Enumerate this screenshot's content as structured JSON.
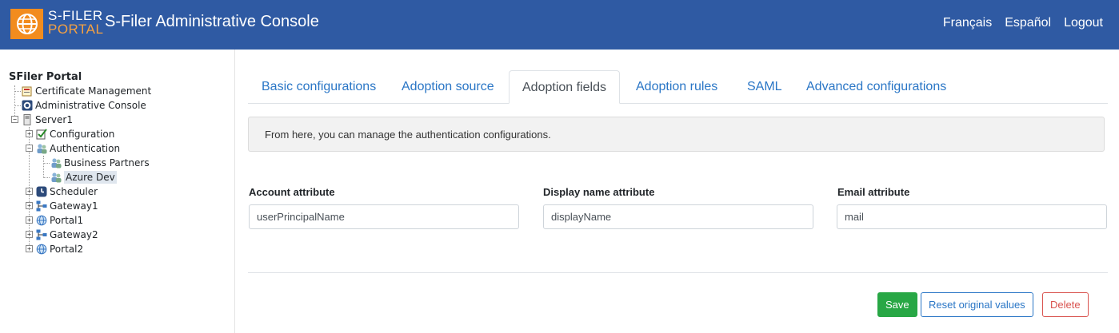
{
  "header": {
    "logo_line1": "S-FILER",
    "logo_line2": "PORTAL",
    "title": "S-Filer Administrative Console",
    "links": [
      "Français",
      "Español",
      "Logout"
    ],
    "logo_bg": "#f28c1e",
    "bar_color": "#2f5aa3"
  },
  "tree": {
    "root": "SFiler Portal",
    "nodes": [
      {
        "label": "Certificate Management",
        "icon": "certificate-icon"
      },
      {
        "label": "Administrative Console",
        "icon": "gear-icon"
      },
      {
        "label": "Server1",
        "icon": "server-icon",
        "expanded": true
      },
      {
        "label": "Configuration",
        "icon": "checklist-icon",
        "expanded": false
      },
      {
        "label": "Authentication",
        "icon": "users-icon",
        "expanded": true
      },
      {
        "label": "Business Partners",
        "icon": "users-icon"
      },
      {
        "label": "Azure Dev",
        "icon": "users-icon",
        "selected": true
      },
      {
        "label": "Scheduler",
        "icon": "clock-icon",
        "expanded": false
      },
      {
        "label": "Gateway1",
        "icon": "network-icon",
        "expanded": false
      },
      {
        "label": "Portal1",
        "icon": "globe-icon",
        "expanded": false
      },
      {
        "label": "Gateway2",
        "icon": "network-icon",
        "expanded": false
      },
      {
        "label": "Portal2",
        "icon": "globe-icon",
        "expanded": false
      }
    ]
  },
  "tabs": [
    "Basic configurations",
    "Adoption source",
    "Adoption fields",
    "Adoption rules",
    "SAML",
    "Advanced configurations"
  ],
  "active_tab": "Adoption fields",
  "info": "From here, you can manage the authentication configurations.",
  "fields": [
    {
      "label": "Account attribute",
      "value": "userPrincipalName"
    },
    {
      "label": "Display name attribute",
      "value": "displayName"
    },
    {
      "label": "Email attribute",
      "value": "mail"
    }
  ],
  "buttons": {
    "save": "Save",
    "reset": "Reset original values",
    "delete": "Delete"
  }
}
